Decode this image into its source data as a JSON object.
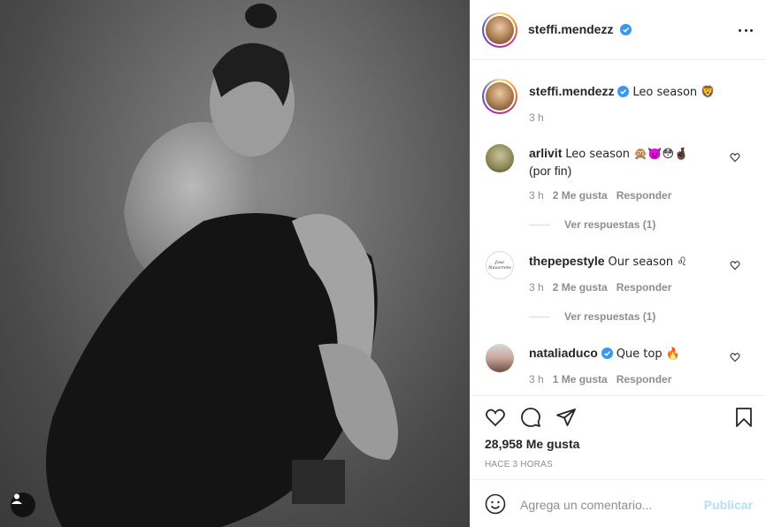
{
  "post": {
    "username": "steffi.mendezz",
    "verified": true,
    "caption": "Leo season 🦁",
    "caption_time": "3 h",
    "likes_text": "28,958 Me gusta",
    "time_ago": "HACE 3 HORAS"
  },
  "comments": [
    {
      "username": "arlivit",
      "text_line1": "Leo season 🙊👿😳🤞🏿",
      "text_line2": "(por fin)",
      "time": "3 h",
      "likes": "2 Me gusta",
      "reply": "Responder",
      "view_replies": "Ver respuestas (1)"
    },
    {
      "username": "thepepestyle",
      "text_line1": "Our season ♌",
      "time": "3 h",
      "likes": "2 Me gusta",
      "reply": "Responder",
      "view_replies": "Ver respuestas (1)",
      "avatar_text": "Jose Navarrete"
    },
    {
      "username": "nataliaduco",
      "verified": true,
      "text_line1": "Que top 🔥",
      "time": "3 h",
      "likes": "1 Me gusta",
      "reply": "Responder"
    }
  ],
  "add_comment": {
    "placeholder": "Agrega un comentario...",
    "publish_label": "Publicar"
  },
  "icons": {
    "more": "more-options-icon",
    "heart": "heart-icon",
    "comment": "comment-icon",
    "share": "share-icon",
    "save": "bookmark-icon",
    "emoji": "emoji-icon",
    "user_tag": "user-tag-icon"
  },
  "colors": {
    "verified_blue": "#3897f0",
    "publish_disabled": "#b2dffc",
    "meta_gray": "#8e8e8e"
  }
}
